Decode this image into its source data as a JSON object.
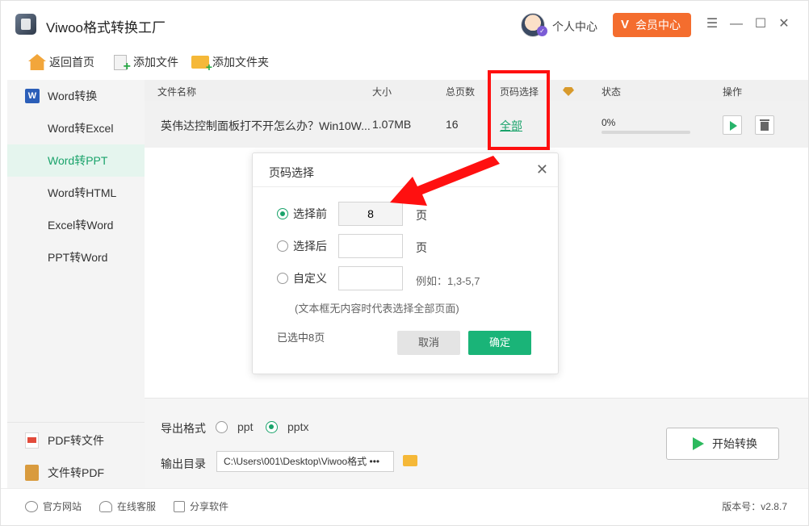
{
  "app": {
    "title": "Viwoo格式转换工厂",
    "user_center": "个人中心",
    "vip": "会员中心",
    "vip_letter": "V"
  },
  "toolbar": {
    "home": "返回首页",
    "add_file": "添加文件",
    "add_folder": "添加文件夹"
  },
  "sidebar": {
    "word_group": "Word转换",
    "items": [
      "Word转Excel",
      "Word转PPT",
      "Word转HTML",
      "Excel转Word",
      "PPT转Word"
    ],
    "active": "Word转PPT",
    "pdf_convert": "PDF转文件",
    "file_to_pdf": "文件转PDF"
  },
  "table": {
    "headers": {
      "name": "文件名称",
      "size": "大小",
      "pages": "总页数",
      "page_select": "页码选择",
      "status": "状态",
      "actions": "操作"
    },
    "rows": [
      {
        "name": "英伟达控制面板打不开怎么办？Win10W...",
        "size": "1.07MB",
        "pages": "16",
        "page_select": "全部",
        "status": "0%",
        "progress": 0
      }
    ]
  },
  "dialog": {
    "title": "页码选择",
    "opt_first": "选择前",
    "opt_last": "选择后",
    "opt_custom": "自定义",
    "first_value": "8",
    "unit": "页",
    "example": "例如：1,3-5,7",
    "note": "(文本框无内容时代表选择全部页面)",
    "selected": "已选中8页",
    "cancel": "取消",
    "ok": "确定"
  },
  "bottom": {
    "format_label": "导出格式",
    "format_options": [
      "ppt",
      "pptx"
    ],
    "format_selected": "pptx",
    "outdir_label": "输出目录",
    "outdir_value": "C:\\Users\\001\\Desktop\\Viwoo格式 •••",
    "start": "开始转换"
  },
  "footer": {
    "site": "官方网站",
    "support": "在线客服",
    "share": "分享软件",
    "version": "版本号：v2.8.7"
  },
  "colors": {
    "accent": "#1aa36b",
    "vip": "#f46d2e",
    "highlight": "#ff1010"
  }
}
